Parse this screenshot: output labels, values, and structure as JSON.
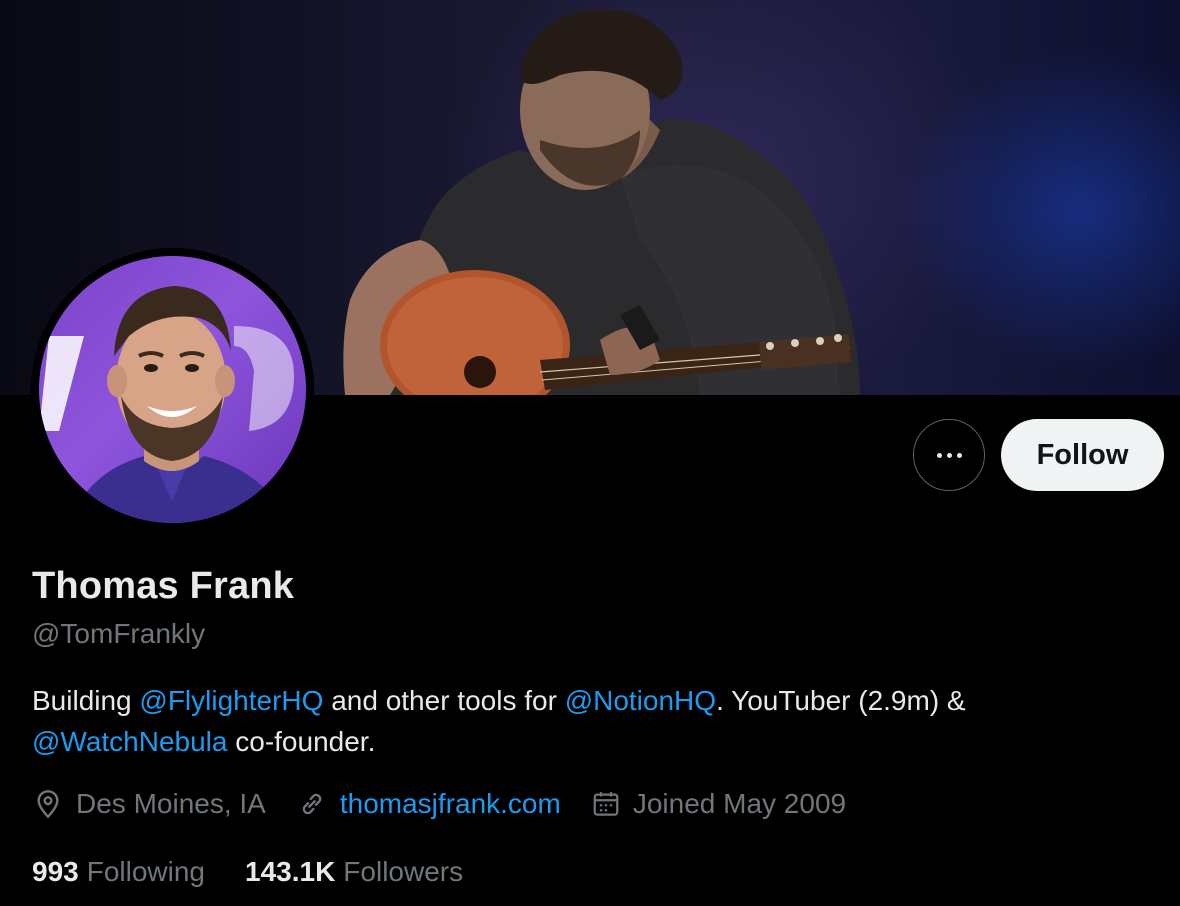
{
  "profile": {
    "name": "Thomas Frank",
    "handle": "@TomFrankly",
    "bio": {
      "t1": "Building ",
      "m1": "@FlylighterHQ",
      "t2": " and other tools for ",
      "m2": "@NotionHQ",
      "t3": ". YouTuber (2.9m) &",
      "m3": "@WatchNebula",
      "t4": " co-founder."
    },
    "location": "Des Moines, IA",
    "website": "thomasjfrank.com",
    "joined": "Joined May 2009"
  },
  "stats": {
    "following_count": "993",
    "following_label": "Following",
    "followers_count": "143.1K",
    "followers_label": "Followers"
  },
  "actions": {
    "follow_label": "Follow",
    "more_icon": "ellipsis-icon"
  },
  "icons": {
    "location": "location-pin-icon",
    "website": "link-icon",
    "joined": "calendar-icon"
  },
  "colors": {
    "background": "#000000",
    "text_primary": "#e7e9ea",
    "text_secondary": "#71767b",
    "accent_link": "#1d9bf0",
    "follow_button_bg": "#eff3f4",
    "follow_button_text": "#0f1419",
    "button_border": "#536471"
  }
}
